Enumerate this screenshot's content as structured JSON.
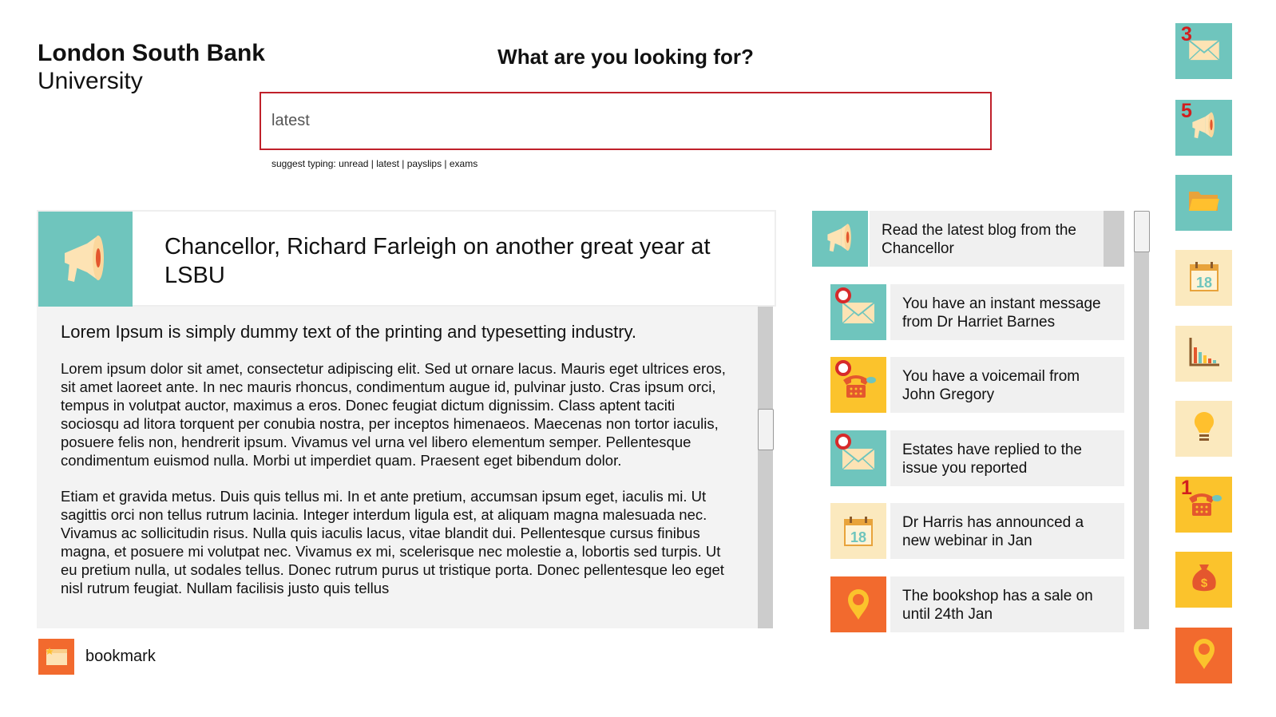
{
  "brand": {
    "line1": "London South Bank",
    "line2": "University"
  },
  "search": {
    "title": "What are you looking for?",
    "value": "latest",
    "hint_prefix": "suggest typing:",
    "suggestions": [
      "unread",
      "latest",
      "payslips",
      "exams"
    ]
  },
  "article": {
    "icon": "megaphone-icon",
    "title": "Chancellor, Richard Farleigh on another great year at LSBU",
    "lead": "Lorem Ipsum is simply dummy text of the printing and typesetting industry.",
    "paragraphs": [
      "Lorem ipsum dolor sit amet, consectetur adipiscing elit. Sed ut ornare lacus. Mauris eget ultrices eros, sit amet laoreet ante. In nec mauris rhoncus, condimentum augue id, pulvinar justo. Cras ipsum orci, tempus in volutpat auctor, maximus a eros. Donec feugiat dictum dignissim. Class aptent taciti sociosqu ad litora torquent per conubia nostra, per inceptos himenaeos. Maecenas non tortor iaculis, posuere felis non, hendrerit ipsum. Vivamus vel urna vel libero elementum semper. Pellentesque condimentum euismod nulla. Morbi ut imperdiet quam. Praesent eget bibendum dolor.",
      "Etiam et gravida metus. Duis quis tellus mi. In et ante pretium, accumsan ipsum eget, iaculis mi. Ut sagittis orci non tellus rutrum lacinia. Integer interdum ligula est, at aliquam magna malesuada nec. Vivamus ac sollicitudin risus. Nulla quis iaculis lacus, vitae blandit dui. Pellentesque cursus finibus magna, et posuere mi volutpat nec. Vivamus ex mi, scelerisque nec molestie a, lobortis sed turpis. Ut eu pretium nulla, ut sodales tellus. Donec rutrum purus ut tristique porta. Donec pellentesque leo eget nisl rutrum feugiat. Nullam facilisis justo quis tellus"
    ]
  },
  "bookmark": {
    "label": "bookmark",
    "icon": "bookmark-window-icon"
  },
  "feed": [
    {
      "text": "Read the latest blog from the Chancellor",
      "icon": "megaphone-icon",
      "color": "#6fc5bd"
    },
    {
      "text": "You have an instant message from Dr Harriet Barnes",
      "icon": "envelope-icon",
      "color": "#6fc5bd",
      "unread": true
    },
    {
      "text": "You have a voicemail from John Gregory",
      "icon": "telephone-icon",
      "color": "#fbc32c",
      "unread": true
    },
    {
      "text": "Estates have replied to the issue you reported",
      "icon": "envelope-icon",
      "color": "#6fc5bd",
      "unread": true
    },
    {
      "text": "Dr Harris has announced a new webinar in Jan",
      "icon": "calendar-icon",
      "color": "#fbe9be"
    },
    {
      "text": "The bookshop has a sale on until 24th Jan",
      "icon": "location-pin-icon",
      "color": "#f26a2e"
    }
  ],
  "sidebar": [
    {
      "icon": "envelope-icon",
      "count": "3",
      "color": "#6fc5bd"
    },
    {
      "icon": "megaphone-icon",
      "count": "5",
      "color": "#6fc5bd"
    },
    {
      "icon": "folder-icon",
      "color": "#6fc5bd"
    },
    {
      "icon": "calendar-icon",
      "color": "#fbe9be"
    },
    {
      "icon": "bar-chart-icon",
      "color": "#fbe9be"
    },
    {
      "icon": "lightbulb-icon",
      "color": "#fbe9be"
    },
    {
      "icon": "telephone-icon",
      "count": "1",
      "color": "#fbc32c"
    },
    {
      "icon": "money-bag-icon",
      "color": "#fbc32c"
    },
    {
      "icon": "location-pin-icon",
      "color": "#f26a2e"
    }
  ],
  "calendar_number": "18",
  "money_symbol": "$"
}
